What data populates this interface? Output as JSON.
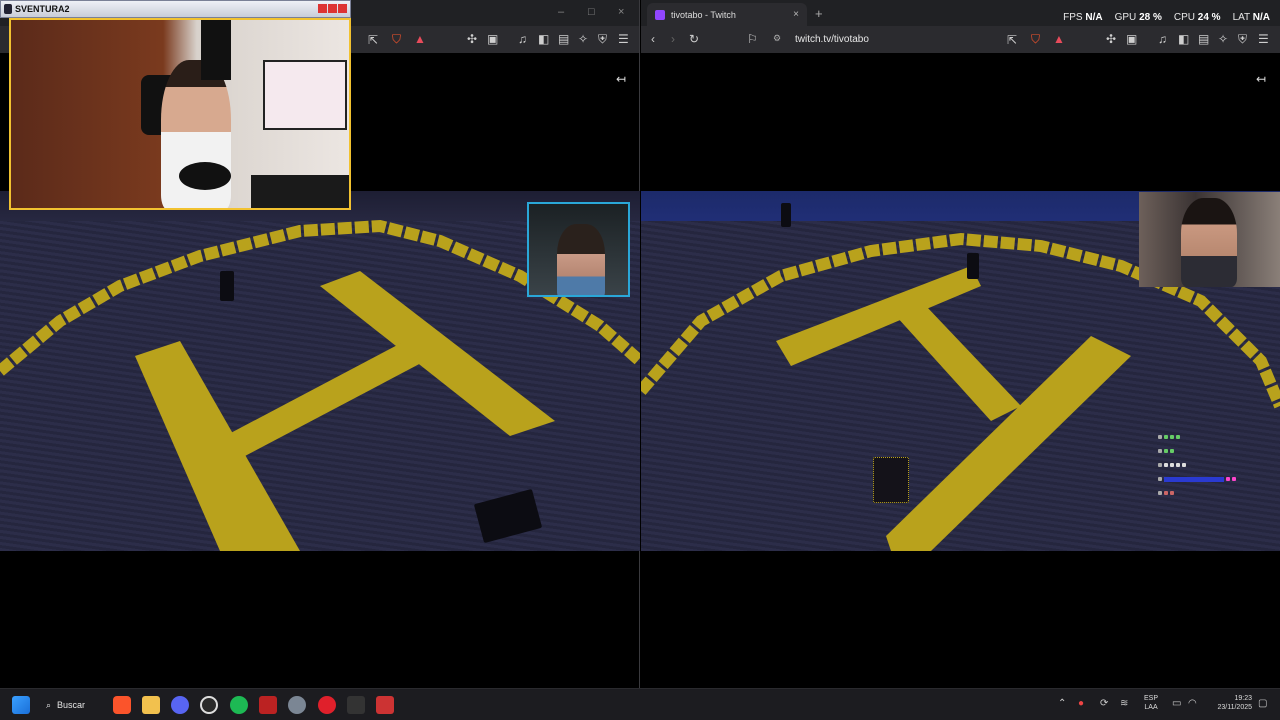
{
  "obs_window": {
    "title": "SVENTURA2"
  },
  "left_browser": {
    "toolbar_icons": [
      "share-icon",
      "brave-shield-icon",
      "brave-rewards-icon",
      "extensions-icon",
      "tab-icon",
      "music-icon",
      "sidebar-icon",
      "wallet-icon",
      "leo-icon",
      "vpn-icon",
      "menu-icon"
    ],
    "window_controls": [
      "–",
      "□",
      "×"
    ],
    "collapse_glyph": "↤"
  },
  "right_browser": {
    "tab_title": "tivotabo - Twitch",
    "tab_close": "×",
    "new_tab": "+",
    "url": "twitch.tv/tivotabo",
    "collapse_glyph": "↤"
  },
  "stats": {
    "fps_label": "FPS",
    "fps_value": "N/A",
    "gpu_label": "GPU",
    "gpu_value": "28 %",
    "cpu_label": "CPU",
    "cpu_value": "24 %",
    "lat_label": "LAT",
    "lat_value": "N/A"
  },
  "taskbar": {
    "search_label": "Buscar",
    "lang_top": "ESP",
    "lang_bottom": "LAA",
    "time": "19:23",
    "date": "23/11/2025",
    "apps": [
      "windows-start-icon",
      "brave-icon",
      "file-explorer-icon",
      "discord-icon",
      "obs-icon",
      "spotify-icon",
      "voicemeeter-icon",
      "settings-icon",
      "opera-icon",
      "epic-games-icon",
      "app-icon"
    ]
  },
  "colors": {
    "webcam_border": "#f2c230",
    "small_cam_border": "#2aa7d8",
    "helipad_yellow": "#b9a21c",
    "twitch_purple": "#9146ff"
  }
}
